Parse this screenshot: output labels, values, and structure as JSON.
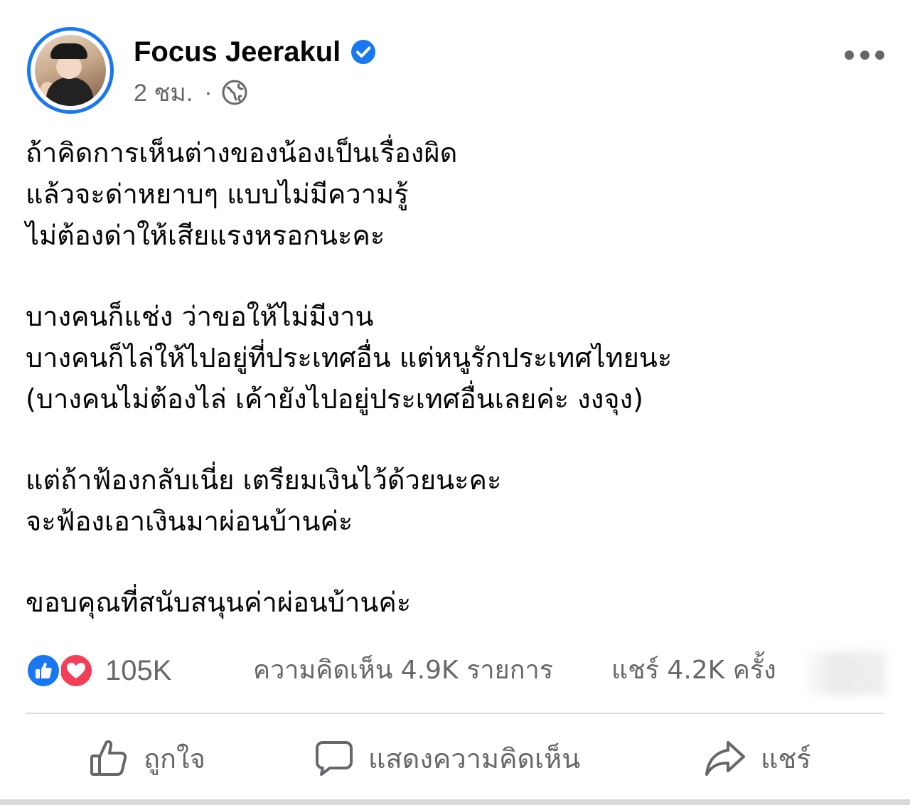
{
  "post": {
    "author_name": "Focus Jeerakul",
    "time": "2 ชม.",
    "separator": "·",
    "lines": [
      "ถ้าคิดการเห็นต่างของน้องเป็นเรื่องผิด",
      "แล้วจะด่าหยาบๆ แบบไม่มีความรู้",
      "ไม่ต้องด่าให้เสียแรงหรอกนะคะ",
      "บางคนก็แช่ง ว่าขอให้ไม่มีงาน",
      "บางคนก็ไล่ให้ไปอยู่ที่ประเทศอื่น แต่หนูรักประเทศไทยนะ",
      "(บางคนไม่ต้องไล่ เค้ายังไปอยู่ประเทศอื่นเลยค่ะ งงจุง)",
      "แต่ถ้าฟ้องกลับเนี่ย เตรียมเงินไว้ด้วยนะคะ",
      "จะฟ้องเอาเงินมาผ่อนบ้านค่ะ",
      "ขอบคุณที่สนับสนุนค่าผ่อนบ้านค่ะ"
    ]
  },
  "stats": {
    "reactions": "105K",
    "comments": "ความคิดเห็น 4.9K รายการ",
    "shares": "แชร์ 4.2K ครั้ง"
  },
  "actions": {
    "like": "ถูกใจ",
    "comment": "แสดงความคิดเห็น",
    "share": "แชร์"
  },
  "icons": {
    "verified": "verified-badge-icon",
    "audience": "globe-icon",
    "more": "more-options-icon",
    "like": "thumbs-up-icon",
    "comment": "comment-bubble-icon",
    "share": "share-arrow-icon"
  },
  "colors": {
    "accent": "#1877f2",
    "love": "#f33e58",
    "secondary_text": "#65676b"
  }
}
